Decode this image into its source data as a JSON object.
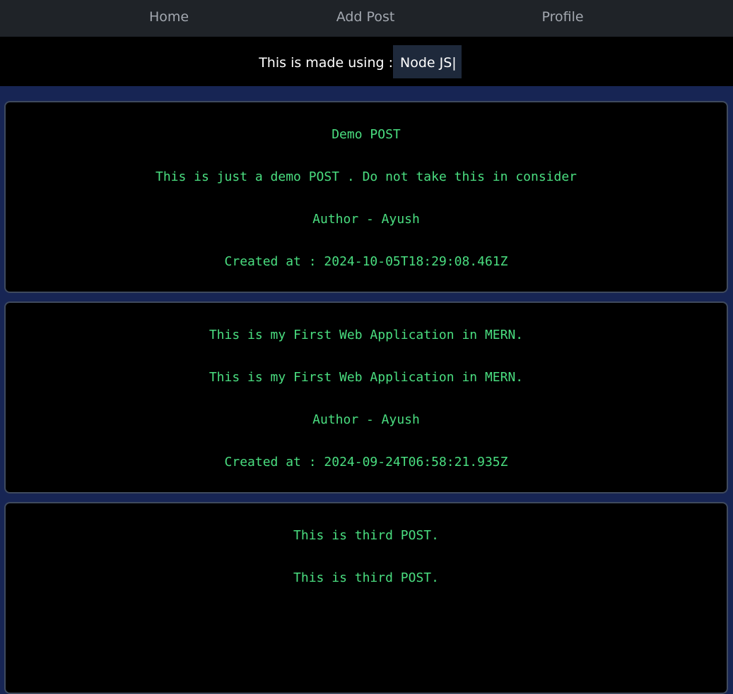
{
  "nav": {
    "links": [
      {
        "label": "Home"
      },
      {
        "label": "Add Post"
      },
      {
        "label": "Profile"
      }
    ]
  },
  "tagline": {
    "prefix": "This is made using :",
    "tech": "Node JS|"
  },
  "posts": [
    {
      "title": "Demo POST",
      "content": "This is just a demo POST . Do not take this in consider",
      "author": "Author - Ayush",
      "created": "Created at : 2024-10-05T18:29:08.461Z"
    },
    {
      "title": "This is my First Web Application in MERN.",
      "content": "This is my First Web Application in MERN.",
      "author": "Author - Ayush",
      "created": "Created at : 2024-09-24T06:58:21.935Z"
    },
    {
      "title": "This is third POST.",
      "content": "This is third POST."
    }
  ]
}
